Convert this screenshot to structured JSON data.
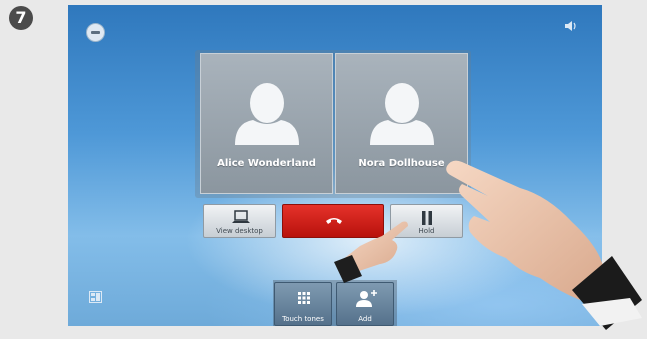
{
  "step_badge": "7",
  "participants": [
    {
      "name": "Alice Wonderland"
    },
    {
      "name": "Nora Dollhouse"
    }
  ],
  "controls": {
    "view_desktop_label": "View desktop",
    "hold_label": "Hold"
  },
  "bottom_buttons": {
    "touch_tones_label": "Touch tones",
    "add_label": "Add"
  },
  "icons": {
    "top_left": "minus-icon",
    "top_right": "speaker-icon",
    "bottom_left": "layout-icon",
    "view_desktop": "laptop-icon",
    "end_call": "phone-hangup-icon",
    "hold": "pause-icon",
    "touch_tones": "keypad-icon",
    "add": "add-person-icon"
  },
  "colors": {
    "end_call": "#cc1f17",
    "step_badge": "#4b4b4b"
  }
}
